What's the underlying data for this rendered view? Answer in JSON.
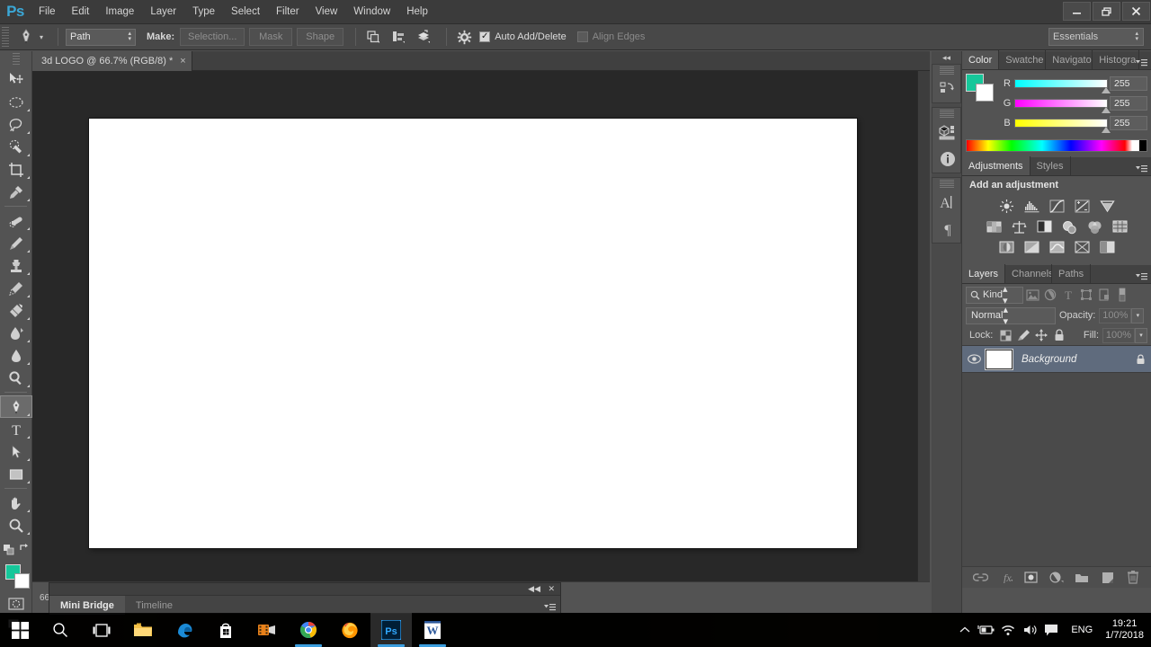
{
  "app": {
    "name": "Adobe Photoshop",
    "logo": "Ps",
    "workspace": "Essentials"
  },
  "menubar": {
    "items": [
      "File",
      "Edit",
      "Image",
      "Layer",
      "Type",
      "Select",
      "Filter",
      "View",
      "Window",
      "Help"
    ]
  },
  "window_controls": {
    "minimize": "minimize-icon",
    "restore": "restore-icon",
    "close": "close-icon"
  },
  "options_bar": {
    "tool_icon": "pen-tool-icon",
    "mode_select": "Path",
    "make_label": "Make:",
    "buttons": [
      "Selection...",
      "Mask",
      "Shape"
    ],
    "path_ops": [
      "path-operations-icon",
      "path-alignment-icon",
      "path-arrangement-icon"
    ],
    "gear": "gear-icon",
    "auto_add_delete": {
      "label": "Auto Add/Delete",
      "checked": true
    },
    "align_edges": {
      "label": "Align Edges",
      "checked": false
    }
  },
  "document": {
    "tab_title": "3d LOGO @ 66.7% (RGB/8) *",
    "close_glyph": "×",
    "zoom_status": "66.",
    "canvas_color": "#ffffff"
  },
  "toolbar": {
    "foreground_color": "#16c79a",
    "background_color": "#ffffff",
    "active_tool": "pen-tool",
    "tools_group_1": [
      "move-tool",
      "marquee-tool",
      "lasso-tool",
      "quick-selection-tool",
      "crop-tool",
      "eyedropper-tool"
    ],
    "tools_group_2": [
      "healing-brush-tool",
      "brush-tool",
      "clone-stamp-tool",
      "history-brush-tool",
      "eraser-tool",
      "gradient-tool",
      "blur-tool",
      "dodge-tool"
    ],
    "tools_group_3": [
      "pen-tool",
      "type-tool",
      "path-selection-tool",
      "shape-tool"
    ],
    "tools_group_4": [
      "hand-tool",
      "zoom-tool"
    ],
    "bottom": [
      "quick-mask-mode",
      "screen-mode"
    ]
  },
  "icon_rail": {
    "collapse": "collapse-panels-icon",
    "groups": [
      [
        "history-icon"
      ],
      [
        "3d-icon",
        "info-icon"
      ],
      [
        "character-icon",
        "paragraph-icon"
      ]
    ]
  },
  "color_panel": {
    "tabs": [
      "Color",
      "Swatche",
      "Navigato",
      "Histogra"
    ],
    "active_tab": "Color",
    "channels": [
      {
        "name": "R",
        "value": "255",
        "gradient": "linear-gradient(to right,#00ffff,#ffffff)"
      },
      {
        "name": "G",
        "value": "255",
        "gradient": "linear-gradient(to right,#ff00ff,#ffffff)"
      },
      {
        "name": "B",
        "value": "255",
        "gradient": "linear-gradient(to right,#ffff00,#ffffff)"
      }
    ],
    "foreground": "#16c79a",
    "background": "#ffffff"
  },
  "adjustments_panel": {
    "tabs": [
      "Adjustments",
      "Styles"
    ],
    "active_tab": "Adjustments",
    "title": "Add an adjustment",
    "rows": [
      [
        "brightness-contrast-icon",
        "levels-icon",
        "curves-icon",
        "exposure-icon",
        "vibrance-icon"
      ],
      [
        "hue-saturation-icon",
        "color-balance-icon",
        "black-white-icon",
        "photo-filter-icon",
        "channel-mixer-icon",
        "color-lookup-icon"
      ],
      [
        "invert-icon",
        "posterize-icon",
        "threshold-icon",
        "selective-color-icon",
        "gradient-map-icon"
      ]
    ]
  },
  "layers_panel": {
    "tabs": [
      "Layers",
      "Channels",
      "Paths"
    ],
    "active_tab": "Layers",
    "filter": {
      "kind_label": "Kind",
      "search_icon": "search-icon",
      "type_icons": [
        "filter-pixel-icon",
        "filter-adjustment-icon",
        "filter-type-icon",
        "filter-shape-icon",
        "filter-smart-object-icon"
      ],
      "toggle": "filter-toggle-icon"
    },
    "blend_mode": "Normal",
    "opacity_label": "Opacity:",
    "opacity_value": "100%",
    "lock_label": "Lock:",
    "lock_icons": [
      "lock-transparent-pixels-icon",
      "lock-image-pixels-icon",
      "lock-position-icon",
      "lock-all-icon"
    ],
    "fill_label": "Fill:",
    "fill_value": "100%",
    "layers": [
      {
        "name": "Background",
        "visible": true,
        "locked": true,
        "thumb_color": "#ffffff"
      }
    ],
    "footer_icons": [
      "link-layers-icon",
      "layer-style-fx-icon",
      "add-layer-mask-icon",
      "new-adjustment-layer-icon",
      "new-group-icon",
      "new-layer-icon",
      "delete-layer-icon"
    ]
  },
  "bottom_panel": {
    "tabs": [
      "Mini Bridge",
      "Timeline"
    ],
    "active_tab": "Mini Bridge",
    "collapse_glyph": "◀◀",
    "close_glyph": "✕"
  },
  "taskbar": {
    "start": "windows-start-icon",
    "items": [
      {
        "name": "search-icon",
        "running": false,
        "active": false
      },
      {
        "name": "task-view-icon",
        "running": false,
        "active": false
      },
      {
        "name": "file-explorer-icon",
        "running": false,
        "active": false
      },
      {
        "name": "edge-browser-icon",
        "running": false,
        "active": false
      },
      {
        "name": "microsoft-store-icon",
        "running": false,
        "active": false
      },
      {
        "name": "media-player-icon",
        "running": false,
        "active": false
      },
      {
        "name": "chrome-browser-icon",
        "running": true,
        "active": false
      },
      {
        "name": "firefox-browser-icon",
        "running": false,
        "active": false
      },
      {
        "name": "photoshop-icon",
        "running": true,
        "active": true
      },
      {
        "name": "word-icon",
        "running": true,
        "active": false
      }
    ],
    "tray": {
      "chevron": "show-hidden-icons-icon",
      "battery": "battery-icon",
      "network": "wifi-icon",
      "volume": "volume-icon",
      "action_center": "action-center-icon",
      "language": "ENG",
      "time": "19:21",
      "date": "1/7/2018"
    }
  }
}
